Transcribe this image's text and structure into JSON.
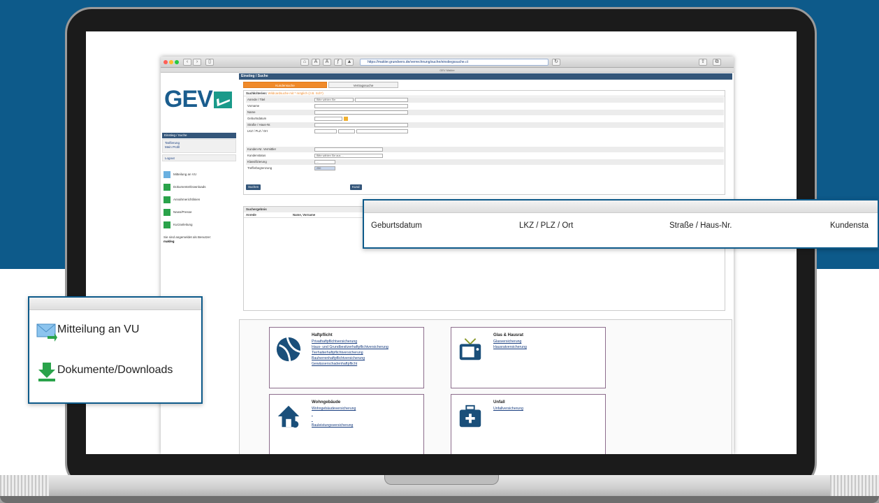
{
  "browser": {
    "url": "https://makler.grundvers.de/verrechnung/suche/einstiegssuche.ct",
    "tab_title": "GEV Makler"
  },
  "logo": {
    "text": "GEV"
  },
  "left_nav": {
    "header": "Einstieg / Suche",
    "items": [
      "Tarifierung",
      "Mein Profil"
    ],
    "logout": "Logout",
    "side_items": [
      "Mitteilung an VU",
      "Dokumente/Downloads",
      "Annahmerichtlinien",
      "News/Presse",
      "Kurzanleitung"
    ],
    "note_prefix": "Sie sind angemeldet als Benutzer:",
    "note_user": "makleg"
  },
  "main": {
    "header": "Einstieg / Suche",
    "tabs": [
      "Kundensuche",
      "Vertragssuche"
    ],
    "criteria_title": "Suchkriterien",
    "criteria_hint": "Wildcardsuche mit * möglich (z.B. Sch*)",
    "rows": [
      {
        "label": "Anrede / Titel",
        "value": "Bitte wählen Sie"
      },
      {
        "label": "Vorname",
        "value": ""
      },
      {
        "label": "Name",
        "value": ""
      },
      {
        "label": "Geburtsdatum",
        "value": ""
      },
      {
        "label": "Straße / Haus-Nr.",
        "value": ""
      },
      {
        "label": "LKZ / PLZ / Ort",
        "value": ""
      }
    ],
    "rows2": [
      {
        "label": "Kunden-Nr. Vermittler",
        "value": ""
      },
      {
        "label": "Kundenstatus",
        "value": "Bitte wählen Sie aus ..."
      },
      {
        "label": "Klassifizierung",
        "value": "..."
      },
      {
        "label": "Trefferbegrenzung",
        "value": "250"
      }
    ],
    "search_button": "Suchen",
    "second_button": "Kund",
    "result_header": "Suchergebnis",
    "result_cols": [
      "Anrede",
      "Name, Vorname"
    ]
  },
  "cards": [
    {
      "title": "Haftpflicht",
      "links": [
        "Privathaftpflichtversicherung",
        "Haus- und Grundbesitzerhaftpflichtversicherung",
        "Tierhalterhaftpflichtversicherung",
        "Bauherrenhaftpflichtversicherung",
        "Gewässerschadenhaftpflicht"
      ]
    },
    {
      "title": "Glas & Hausrat",
      "links": [
        "Glasversicherung",
        "Hausratversicherung"
      ]
    },
    {
      "title": "Wohngebäude",
      "links": [
        "Wohngebäudeversicherung",
        "",
        "",
        "Bauleistungsversicherung"
      ]
    },
    {
      "title": "Unfall",
      "links": [
        "Unfallversicherung"
      ]
    }
  ],
  "callout_right": {
    "columns": [
      "Geburtsdatum",
      "LKZ / PLZ / Ort",
      "Straße / Haus-Nr.",
      "Kundensta"
    ]
  },
  "callout_left": {
    "items": [
      "Mitteilung an VU",
      "Dokumente/Downloads"
    ]
  },
  "colors": {
    "brand_blue": "#0d5a8a",
    "nav_blue": "#34567a",
    "accent_orange": "#f08a2a",
    "icon_green": "#2aa34a"
  }
}
